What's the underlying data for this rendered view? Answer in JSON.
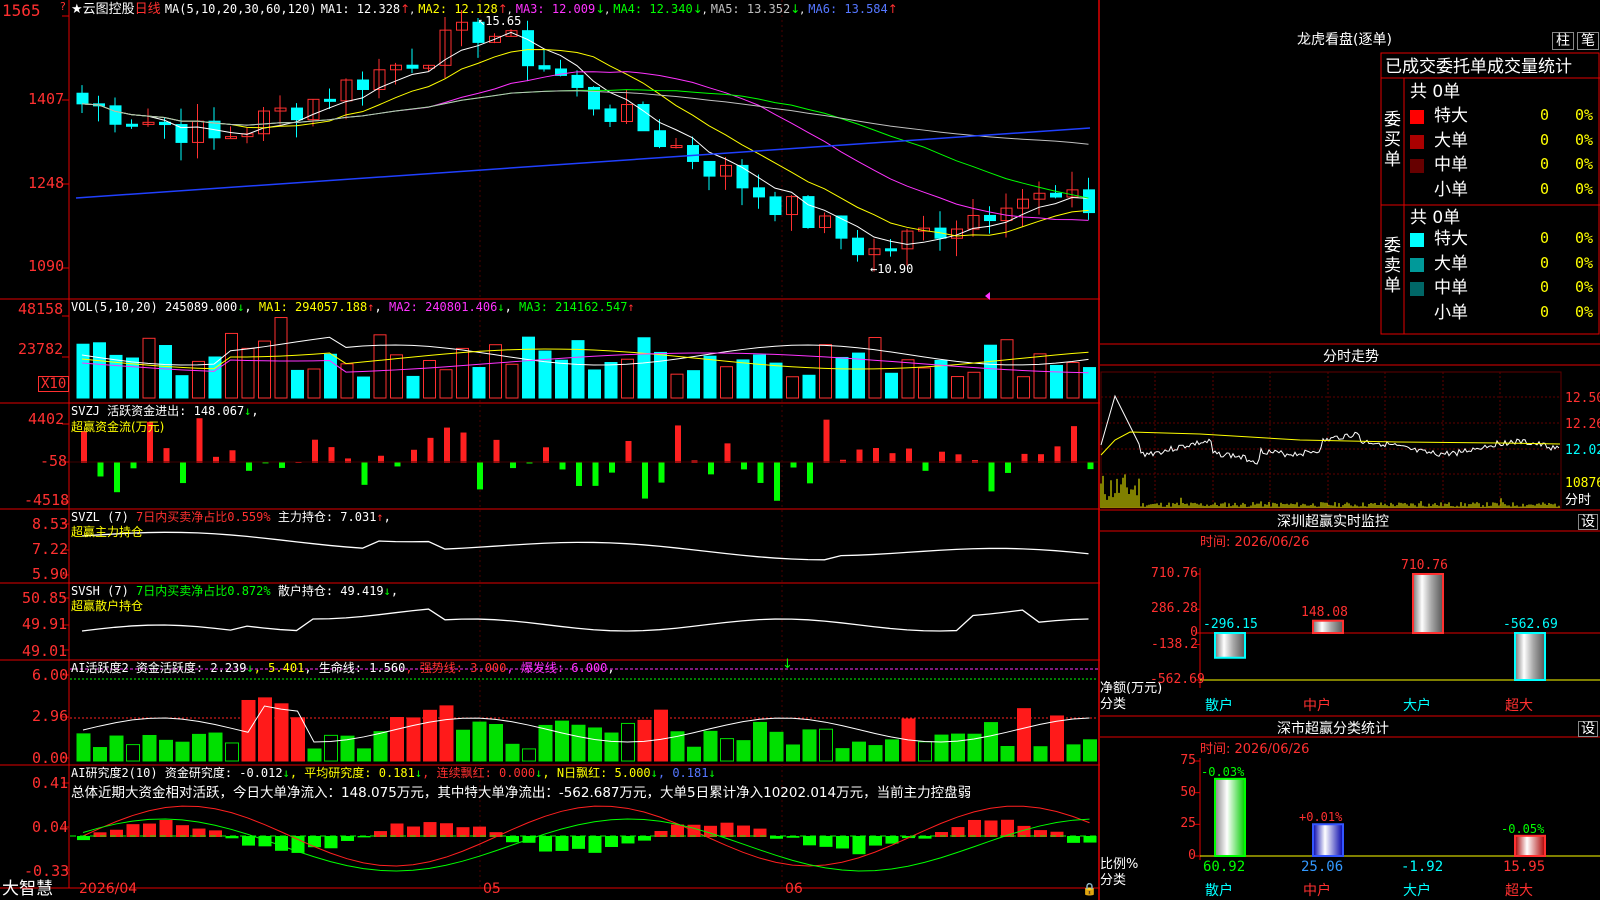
{
  "app": {
    "brand": "大智慧",
    "star": "★",
    "stock_name": "云图控股",
    "period": "日线",
    "alert": "?"
  },
  "main_chart": {
    "ma_label": "MA(5,10,20,30,60,120)",
    "ma1": "MA1: 12.328",
    "ma2": "MA2: 12.128",
    "ma3": "MA3: 12.009",
    "ma4": "MA4: 12.340",
    "ma5": "MA5: 13.352",
    "ma6": "MA6: 13.584",
    "arrows": [
      "↑",
      "↑",
      "↓",
      "↓",
      "↓",
      "↑"
    ],
    "y_ticks": [
      "1565",
      "1407",
      "1248",
      "1090"
    ],
    "high_marker": "15.65",
    "low_marker": "←10.90",
    "x_labels": [
      "2026/04",
      "05",
      "06"
    ]
  },
  "vol_panel": {
    "label": "VOL(5,10,20)",
    "value": "245089.000",
    "v_arrow": "↓",
    "ma1": "MA1: 294057.188",
    "ma1_arrow": "↑",
    "ma2": "MA2: 240801.406",
    "ma2_arrow": "↓",
    "ma3": "MA3: 214162.547",
    "ma3_arrow": "↑",
    "y_ticks": [
      "48158",
      "23782"
    ],
    "unit": "X10"
  },
  "svzj_panel": {
    "label": "SVZJ",
    "title": "活跃资金进出: 148.067",
    "arrow": "↓",
    ",": ",",
    "subtitle": "超赢资金流(万元)",
    "y_ticks": [
      "4402",
      "-58",
      "-4518"
    ]
  },
  "svzl_panel": {
    "label": "SVZL (7)",
    "text1": "7日内买卖净占比0.559%",
    "text2": "主力持仓: 7.031",
    "arrow": "↑",
    "comma": ",",
    "subtitle": "超赢主力持仓",
    "y_ticks": [
      "8.53",
      "7.22",
      "5.90"
    ]
  },
  "svsh_panel": {
    "label": "SVSH (7)",
    "text1": "7日内买卖净占比0.872%",
    "text2": "散户持仓: 49.419",
    "arrow": "↓",
    "comma": ",",
    "subtitle": "超赢散户持仓",
    "y_ticks": [
      "50.85",
      "49.91",
      "49.01"
    ]
  },
  "ai_active_panel": {
    "label": "AI活跃度2",
    "t1": "资金活跃度: 2.239",
    "a1": "↓",
    "t2": ", 5.401",
    "t3": ", 生命线: 1.560",
    "t4": ", 强势线: 3.000",
    "t5": ", 爆发线: 6.000",
    "t6": ",",
    "y_ticks": [
      "6.00",
      "2.96",
      "0.00"
    ]
  },
  "ai_research_panel": {
    "label": "AI研究度2(10)",
    "t1": "资金研究度: -0.012",
    "a1": "↓",
    "t2": ", 平均研究度: 0.181",
    "a2": "↓",
    "t3": ", 连续飘红: 0.000",
    "a3": "↓",
    "t4": ", N日飘红: 5.000",
    "a4": "↓",
    "t5": ", 0.181",
    "a5": "↓",
    "summary": "总体近期大资金相对活跃，今日大单净流入：148.075万元，其中特大单净流出：-562.687万元，大单5日累计净入10202.014万元，当前主力控盘弱",
    "y_ticks": [
      "0.41",
      "0.04",
      "-0.33"
    ]
  },
  "dragon_panel": {
    "title": "龙虎看盘(逐单)",
    "btn1": "柱",
    "btn2": "笔",
    "header": "已成交委托单成交量统计",
    "buy_side": "委买单",
    "sell_side": "委卖单",
    "buy_total": "共 0单",
    "sell_total": "共 0单",
    "buy_rows": [
      {
        "name": "特大",
        "count": "0",
        "pct": "0%",
        "color": "#ff0000"
      },
      {
        "name": "大单",
        "count": "0",
        "pct": "0%",
        "color": "#aa0000"
      },
      {
        "name": "中单",
        "count": "0",
        "pct": "0%",
        "color": "#660000"
      },
      {
        "name": "小单",
        "count": "0",
        "pct": "0%",
        "color": "#000000"
      }
    ],
    "sell_rows": [
      {
        "name": "特大",
        "count": "0",
        "pct": "0%",
        "color": "#00ffff"
      },
      {
        "name": "大单",
        "count": "0",
        "pct": "0%",
        "color": "#009999"
      },
      {
        "name": "中单",
        "count": "0",
        "pct": "0%",
        "color": "#006666"
      },
      {
        "name": "小单",
        "count": "0",
        "pct": "0%",
        "color": "#000000"
      }
    ]
  },
  "intraday_panel": {
    "title": "分时走势",
    "prices": [
      "12.50",
      "12.26",
      "12.02"
    ],
    "vol": "10876",
    "vol_label": "分时"
  },
  "sz_monitor": {
    "title": "深圳超赢实时监控",
    "settings": "设",
    "date": "时间: 2026/06/26",
    "y_ticks": [
      "710.76",
      "286.28",
      "0",
      "-138.2",
      "-562.69"
    ],
    "unit": "净额(万元)",
    "cat_label": "分类",
    "categories": [
      "散户",
      "中户",
      "大户",
      "超大"
    ],
    "values": [
      -296.15,
      148.08,
      710.76,
      -562.69
    ],
    "value_labels": [
      "-296.15",
      "148.08",
      "710.76",
      "-562.69"
    ]
  },
  "sz_class": {
    "title": "深市超赢分类统计",
    "settings": "设",
    "date": "时间: 2026/06/26",
    "y_ticks": [
      "75",
      "50",
      "25",
      "0"
    ],
    "ratio_label": "比例%",
    "cat_label": "分类",
    "categories": [
      "散户",
      "中户",
      "大户",
      "超大"
    ],
    "values": [
      60.92,
      25.06,
      -1.92,
      15.95
    ],
    "value_labels": [
      "60.92",
      "25.06",
      "-1.92",
      "15.95"
    ],
    "changes": [
      "-0.03%",
      "+0.01%",
      "",
      "-0.05%"
    ]
  },
  "chart_data": {
    "type": "bar",
    "title": "深圳超赢实时监控",
    "ylabel": "净额(万元)",
    "categories": [
      "散户",
      "中户",
      "大户",
      "超大"
    ],
    "values": [
      -296.15,
      148.08,
      710.76,
      -562.69
    ],
    "ylim": [
      -562.69,
      710.76
    ],
    "second_chart": {
      "title": "深市超赢分类统计",
      "ylabel": "比例%",
      "categories": [
        "散户",
        "中户",
        "大户",
        "超大"
      ],
      "values": [
        60.92,
        25.06,
        -1.92,
        15.95
      ],
      "ylim": [
        0,
        75
      ]
    },
    "candlestick": {
      "high": 15.65,
      "low": 10.9,
      "ma": {
        "MA1": 12.328,
        "MA2": 12.128,
        "MA3": 12.009,
        "MA4": 12.34,
        "MA5": 13.352,
        "MA6": 13.584
      },
      "ylim": [
        10.9,
        15.65
      ]
    },
    "volume": {
      "VOL": 245089.0,
      "MA1": 294057.188,
      "MA2": 240801.406,
      "MA3": 214162.547
    }
  }
}
